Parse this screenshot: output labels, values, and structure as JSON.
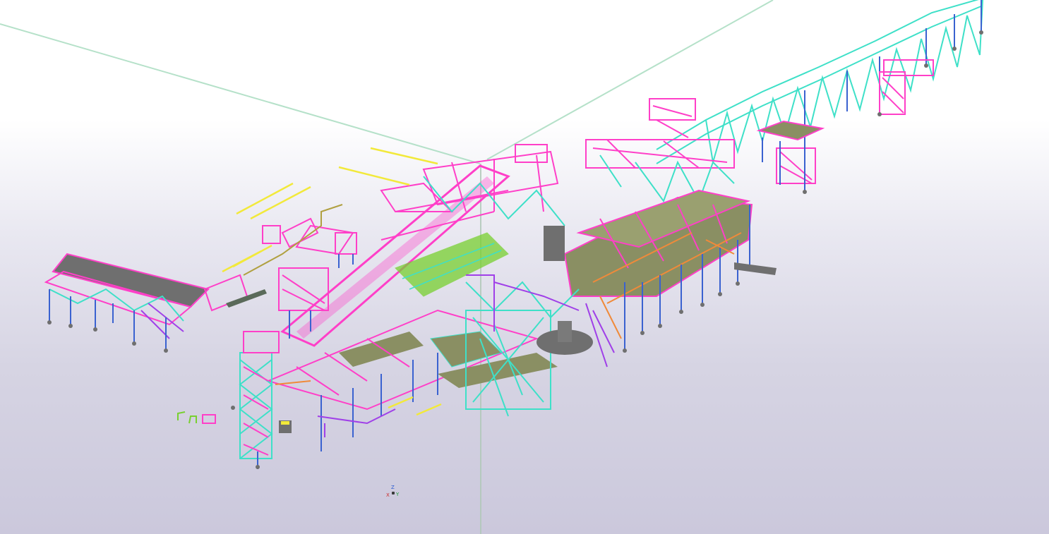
{
  "view": {
    "name": "3D model view",
    "background": {
      "top": "#ffffff",
      "bottom": "#cbc8dc"
    }
  },
  "axis_triad": {
    "z_label": "Z",
    "x_label": "X",
    "y_label": "Y"
  },
  "colors": {
    "handrail": "#ff3fc8",
    "bracing": "#3ee0c8",
    "column": "#3a62d0",
    "grating": "#8a8f63",
    "purple_member": "#a040e8",
    "conveyor_yellow": "#f2e93a",
    "orange_member": "#f08a3a",
    "concrete": "#6f6f6f",
    "green_member": "#78d030",
    "gridline": "#9fdcb4"
  }
}
